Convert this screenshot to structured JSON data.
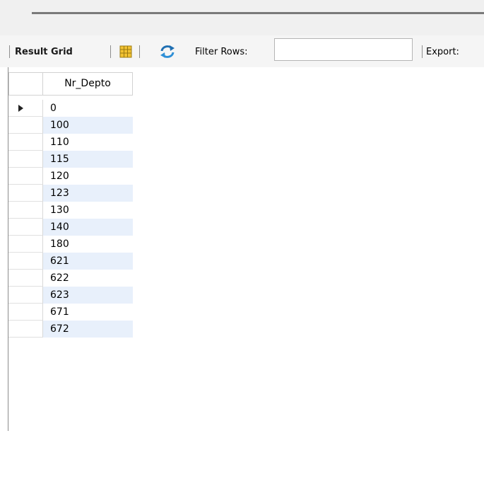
{
  "toolbar": {
    "result_grid_label": "Result Grid",
    "grid_icon": "grid-columns-icon",
    "refresh_icon": "refresh-arrows-icon",
    "filter_label": "Filter Rows:",
    "filter_value": "",
    "export_label": "Export:"
  },
  "grid": {
    "column_header": "Nr_Depto",
    "rows": [
      "0",
      "100",
      "110",
      "115",
      "120",
      "123",
      "130",
      "140",
      "180",
      "621",
      "622",
      "623",
      "671",
      "672"
    ],
    "current_row_indicator": "row-arrow-icon"
  },
  "colors": {
    "alt_row": "#e8f0fb",
    "grid_icon_fill": "#f2c232",
    "refresh_icon": "#1f6fb2"
  }
}
